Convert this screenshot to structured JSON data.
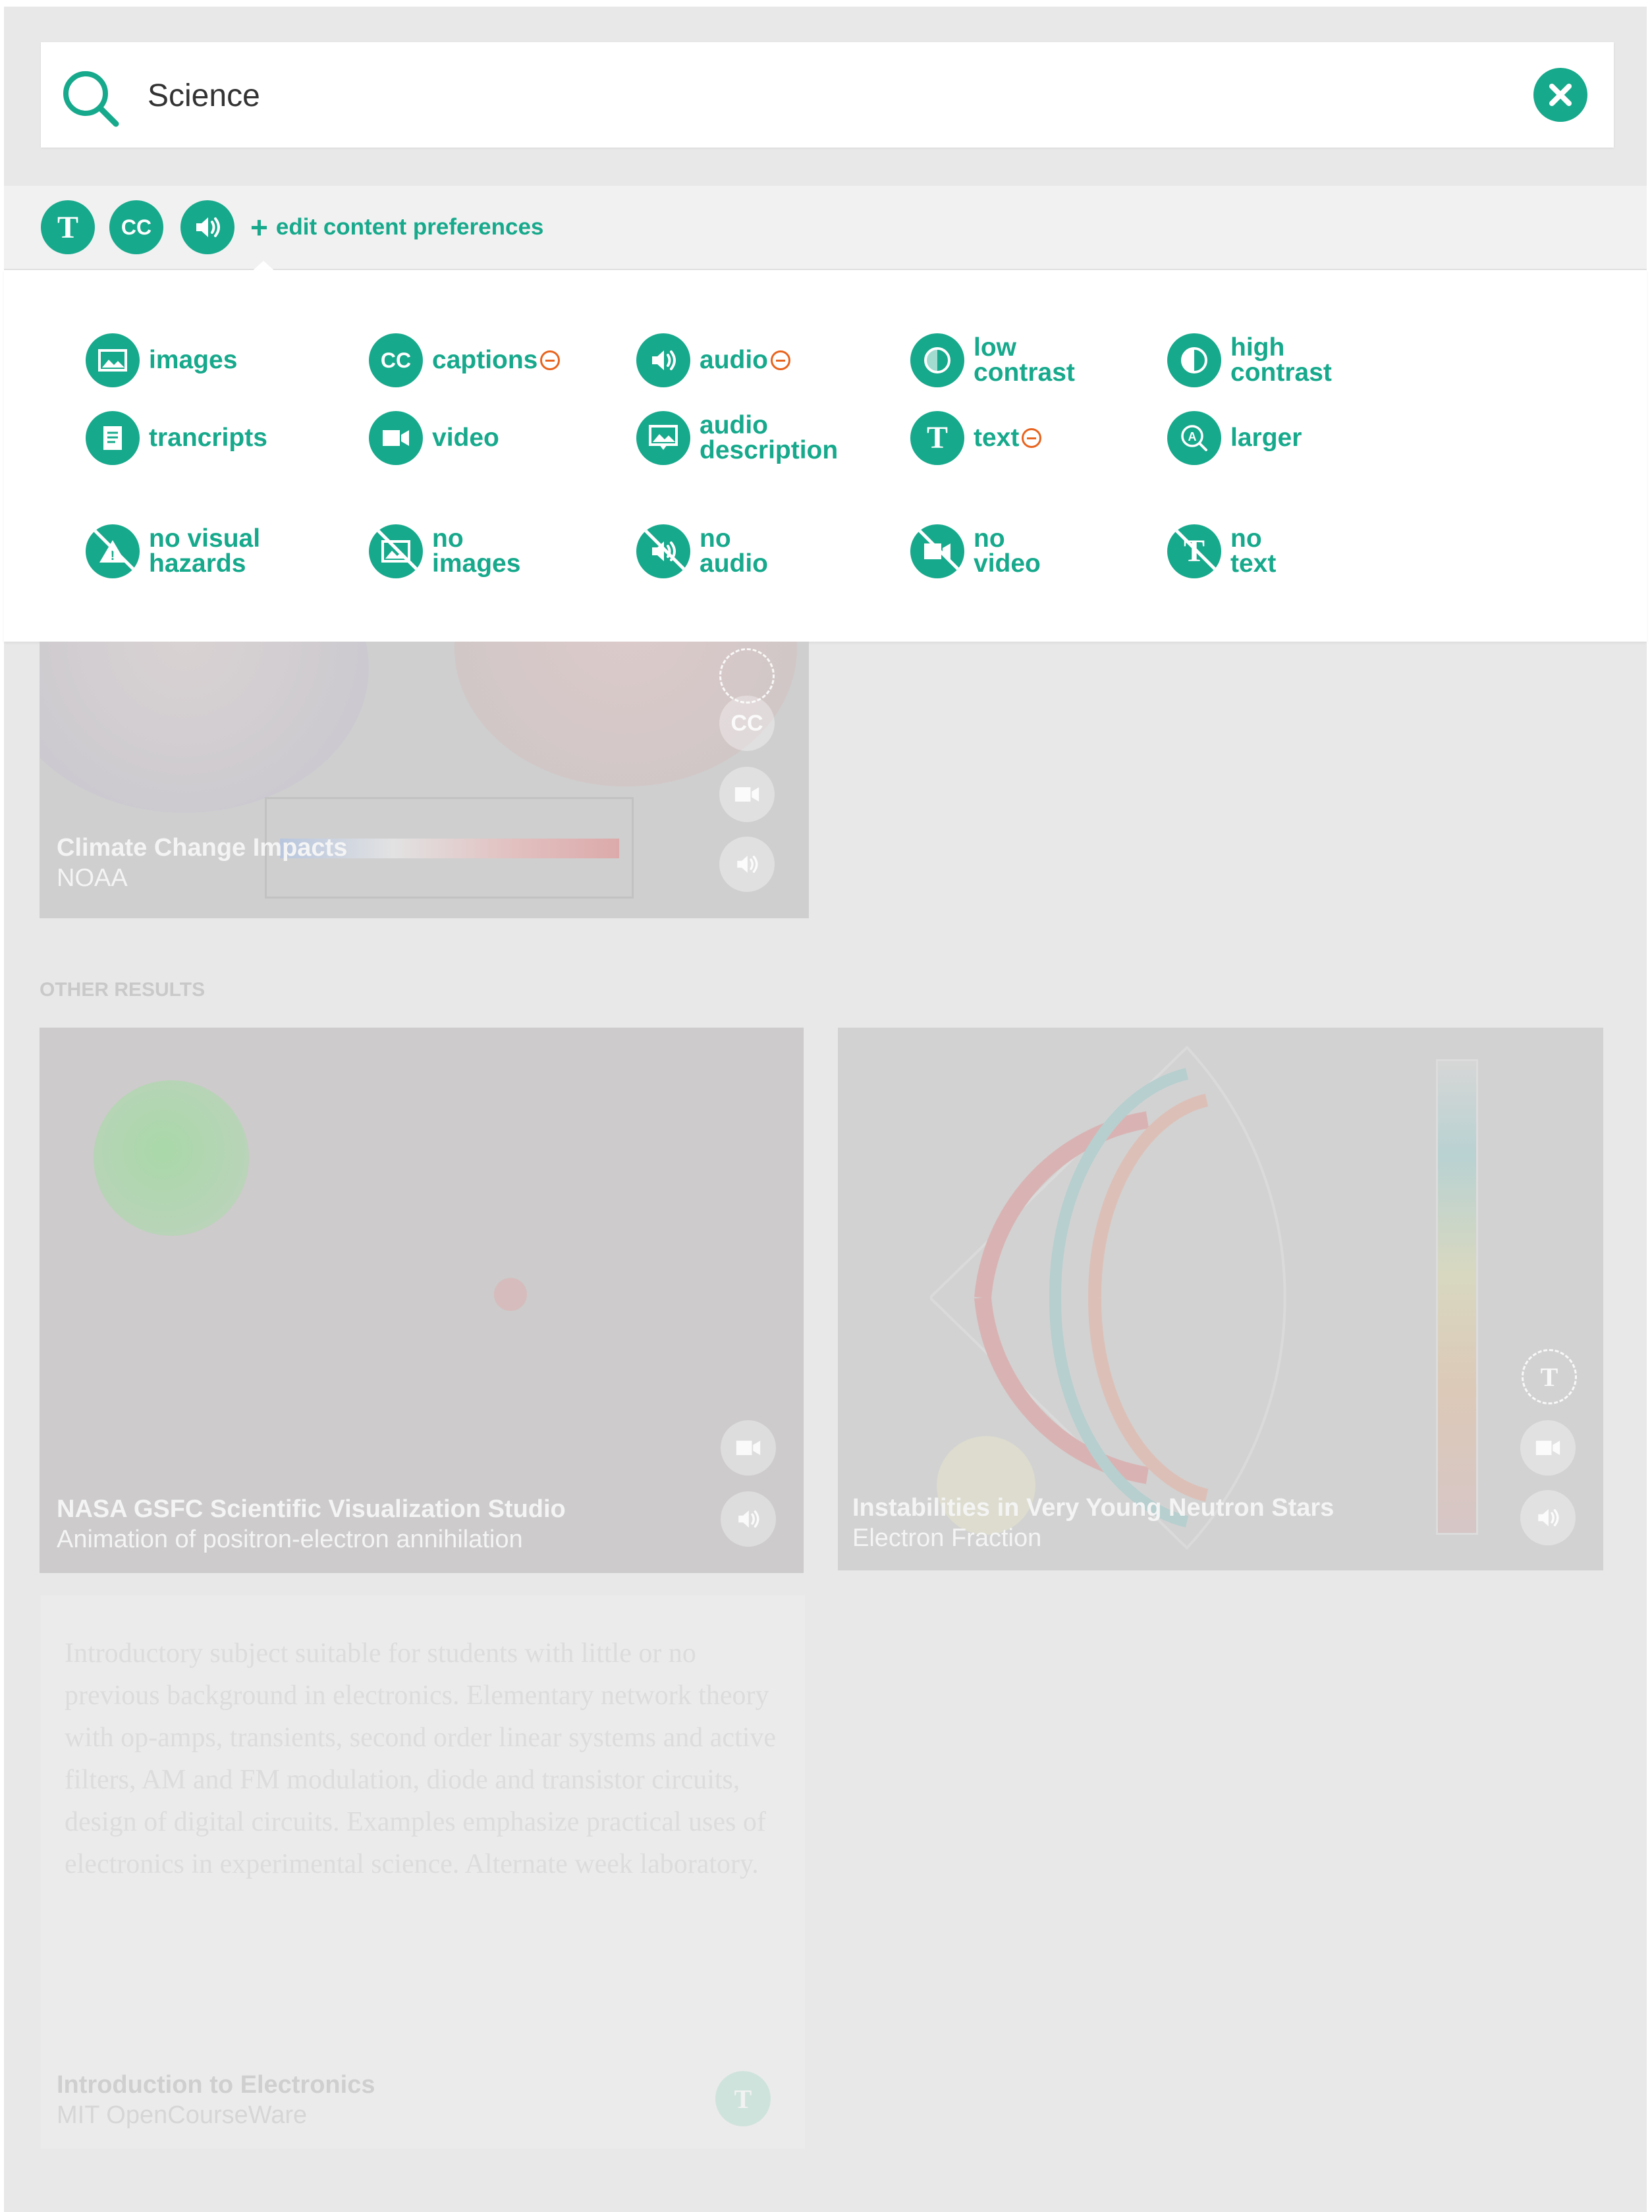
{
  "search": {
    "value": "Science"
  },
  "toolbar": {
    "icons": [
      {
        "name": "text-icon",
        "glyph": "T"
      },
      {
        "name": "captions-icon",
        "glyph": "CC"
      },
      {
        "name": "audio-icon",
        "glyph": "audio"
      }
    ],
    "edit_label": "edit content preferences"
  },
  "preferences": {
    "images": "images",
    "captions": "captions",
    "audio": "audio",
    "low_contrast_1": "low",
    "low_contrast_2": "contrast",
    "high_contrast_1": "high",
    "high_contrast_2": "contrast",
    "transcripts": "trancripts",
    "video": "video",
    "audio_description_1": "audio",
    "audio_description_2": "description",
    "text": "text",
    "larger": "larger",
    "no_visual_hazards_1": "no visual",
    "no_visual_hazards_2": "hazards",
    "no_images_1": "no",
    "no_images_2": "images",
    "no_audio_1": "no",
    "no_audio_2": "audio",
    "no_video_1": "no",
    "no_video_2": "video",
    "no_text_1": "no",
    "no_text_2": "text"
  },
  "results": {
    "featured": {
      "title": "Climate Change Impacts",
      "source": "NOAA"
    },
    "other_label": "OTHER RESULTS",
    "card1": {
      "title": "NASA GSFC Scientific Visualization Studio",
      "source": "Animation of positron-electron annihilation"
    },
    "card2": {
      "title": "Instabilities in Very Young Neutron Stars",
      "source": "Electron Fraction"
    },
    "card3": {
      "description": "Introductory subject suitable for students with little or no previous background in electronics. Elementary network theory with op-amps, transients, second order linear systems and active filters, AM and FM modulation, diode and transistor circuits, design of digital circuits. Examples emphasize practical uses of electronics in experimental science. Alternate week laboratory.",
      "title": "Introduction to Electronics",
      "source": "MIT OpenCourseWare"
    }
  },
  "colors": {
    "accent": "#17a98c",
    "warning": "#e8631e",
    "backdrop": "#e8e8e8"
  }
}
